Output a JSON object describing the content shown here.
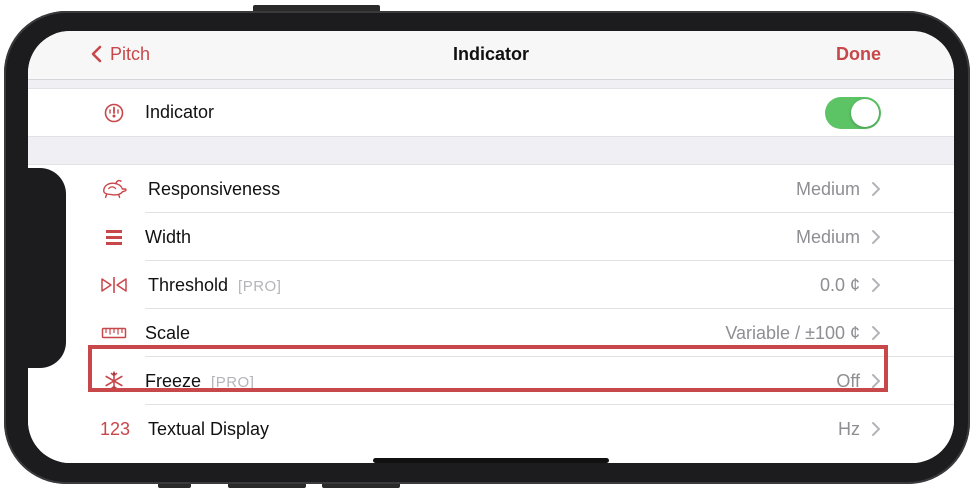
{
  "navbar": {
    "back_label": "Pitch",
    "title": "Indicator",
    "done_label": "Done"
  },
  "indicator_row": {
    "label": "Indicator",
    "toggle_on": true,
    "icon": "gauge-icon"
  },
  "rows": [
    {
      "label": "Responsiveness",
      "pro": "",
      "value": "Medium",
      "icon": "rabbit-turtle-icon"
    },
    {
      "label": "Width",
      "pro": "",
      "value": "Medium",
      "icon": "width-bars-icon"
    },
    {
      "label": "Threshold",
      "pro": "[PRO]",
      "value": "0.0 ¢",
      "icon": "threshold-icon"
    },
    {
      "label": "Scale",
      "pro": "",
      "value": "Variable / ±100 ¢",
      "icon": "ruler-icon"
    },
    {
      "label": "Freeze",
      "pro": "[PRO]",
      "value": "Off",
      "icon": "snowflake-icon"
    },
    {
      "label": "Textual Display",
      "pro": "",
      "value": "Hz",
      "icon": "numbers-icon",
      "icon_text": "123"
    }
  ],
  "colors": {
    "accent": "#c8474a",
    "toggle_on": "#5cc465",
    "value_gray": "#8e8e93",
    "pro_gray": "#b4b4b9"
  }
}
